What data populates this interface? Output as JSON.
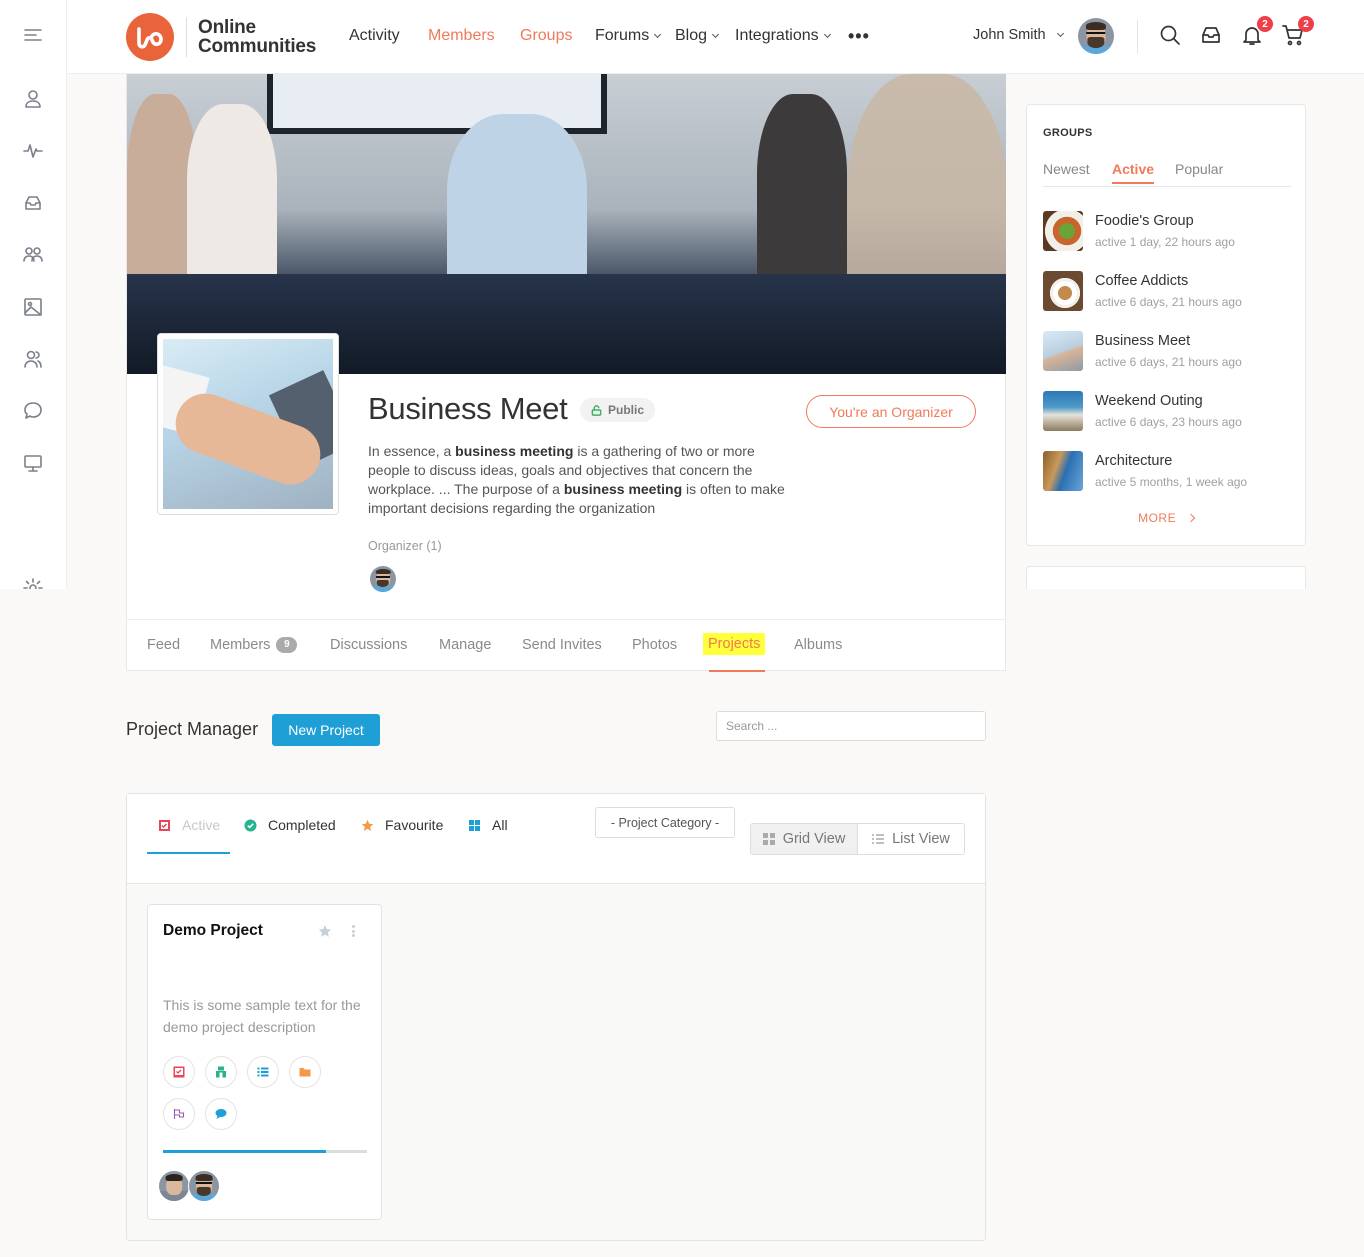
{
  "brand": {
    "name_line1": "Online",
    "name_line2": "Communities",
    "color": "#e9643b"
  },
  "sidebar": {
    "items": [
      {
        "name": "menu",
        "icon": "hamburger-icon"
      },
      {
        "name": "profile",
        "icon": "user-icon"
      },
      {
        "name": "activity",
        "icon": "activity-icon"
      },
      {
        "name": "inbox",
        "icon": "inbox-icon"
      },
      {
        "name": "groups",
        "icon": "groups-icon"
      },
      {
        "name": "photos",
        "icon": "image-icon"
      },
      {
        "name": "members",
        "icon": "members-icon"
      },
      {
        "name": "forums",
        "icon": "chat-icon"
      },
      {
        "name": "courses",
        "icon": "monitor-icon"
      },
      {
        "name": "settings",
        "icon": "gear-icon"
      }
    ]
  },
  "nav": {
    "items": [
      {
        "label": "Activity",
        "active": false,
        "dropdown": false
      },
      {
        "label": "Members",
        "active": true,
        "dropdown": false
      },
      {
        "label": "Groups",
        "active": true,
        "dropdown": false
      },
      {
        "label": "Forums",
        "active": false,
        "dropdown": true
      },
      {
        "label": "Blog",
        "active": false,
        "dropdown": true
      },
      {
        "label": "Integrations",
        "active": false,
        "dropdown": true
      }
    ],
    "more_label": "•••"
  },
  "user": {
    "name": "John Smith",
    "notifications_count": "2",
    "cart_count": "2"
  },
  "group": {
    "title": "Business Meet",
    "privacy_label": "Public",
    "organizer_button": "You're an Organizer",
    "description": [
      {
        "text": "In essence, a ",
        "bold": false
      },
      {
        "text": "business meeting",
        "bold": true
      },
      {
        "text": " is a gathering of two or more people to discuss ideas, goals and objectives that concern the workplace. ... The purpose of a ",
        "bold": false
      },
      {
        "text": "business meeting",
        "bold": true
      },
      {
        "text": " is often to make important decisions regarding the organization",
        "bold": false
      }
    ],
    "organizer_label": "Organizer (1)",
    "tabs": [
      {
        "label": "Feed"
      },
      {
        "label": "Members",
        "count": "9"
      },
      {
        "label": "Discussions"
      },
      {
        "label": "Manage"
      },
      {
        "label": "Send Invites"
      },
      {
        "label": "Photos"
      },
      {
        "label": "Projects",
        "current": true
      },
      {
        "label": "Albums"
      }
    ]
  },
  "groups_widget": {
    "title": "GROUPS",
    "tabs": [
      "Newest",
      "Active",
      "Popular"
    ],
    "active_tab": "Active",
    "items": [
      {
        "name": "Foodie's Group",
        "meta": "active 1 day, 22 hours ago"
      },
      {
        "name": "Coffee Addicts",
        "meta": "active 6 days, 21 hours ago"
      },
      {
        "name": "Business Meet",
        "meta": "active 6 days, 21 hours ago"
      },
      {
        "name": "Weekend Outing",
        "meta": "active 6 days, 23 hours ago"
      },
      {
        "name": "Architecture",
        "meta": "active 5 months, 1 week ago"
      }
    ],
    "more_label": "MORE"
  },
  "project_manager": {
    "title": "Project Manager",
    "new_button": "New Project",
    "search_placeholder": "Search ...",
    "filters": [
      {
        "label": "Active",
        "icon": "checkbox-icon",
        "color": "#e8445a",
        "active": true
      },
      {
        "label": "Completed",
        "icon": "check-circle-icon",
        "color": "#27b38d",
        "active": false
      },
      {
        "label": "Favourite",
        "icon": "star-icon",
        "color": "#f2994a",
        "active": false
      },
      {
        "label": "All",
        "icon": "grid-icon",
        "color": "#1e9fd6",
        "active": false
      }
    ],
    "category_select": "- Project Category -",
    "views": [
      {
        "label": "Grid View",
        "selected": true
      },
      {
        "label": "List View",
        "selected": false
      }
    ],
    "accent": "#1e9fd6",
    "projects": [
      {
        "title": "Demo Project",
        "description": "This is some sample text for the demo project description",
        "progress_percent": 80,
        "action_icons": [
          "task-list-icon",
          "milestone-icon",
          "list-icon",
          "folder-icon",
          "flag-icon",
          "comment-icon"
        ],
        "member_count": 2
      }
    ]
  }
}
